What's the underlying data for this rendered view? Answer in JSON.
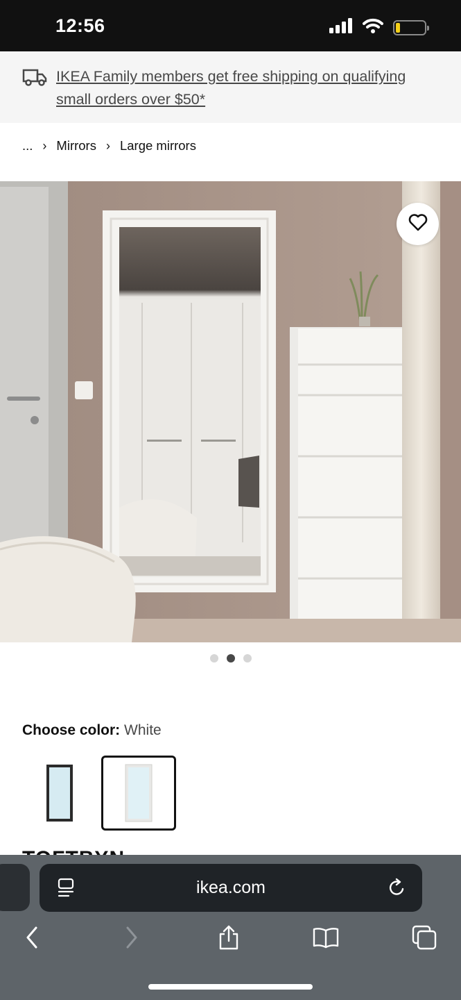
{
  "status": {
    "time": "12:56",
    "icons": [
      "signal-icon",
      "wifi-icon",
      "battery-icon"
    ],
    "battery_level": 0.15
  },
  "promo": {
    "icon": "truck-icon",
    "text": "IKEA Family members get free shipping on qualifying small orders over $50*"
  },
  "breadcrumb": {
    "items": [
      "...",
      "Mirrors",
      "Large mirrors"
    ],
    "separator": "›"
  },
  "gallery": {
    "favorite_icon": "heart-icon",
    "dots_count": 3,
    "active_dot": 2
  },
  "color": {
    "label": "Choose color:",
    "value": "White",
    "options": [
      {
        "name": "black-mirror-swatch",
        "frame_color": "#2b2b2b",
        "selected": false
      },
      {
        "name": "white-mirror-swatch",
        "frame_color": "#e6e6e6",
        "selected": true
      }
    ]
  },
  "product": {
    "title_partial": "TOFTBYN"
  },
  "browser": {
    "url": "ikea.com",
    "icons": [
      "reader-icon",
      "reload-icon",
      "back-icon",
      "forward-icon",
      "share-icon",
      "bookmarks-icon",
      "tabs-icon"
    ]
  },
  "colors": {
    "status_bg": "#111111",
    "promo_bg": "#f5f5f5",
    "browser_bg": "#5e6469",
    "urlbar_bg": "#1f2327",
    "wall": "#a89488",
    "accent_battery": "#f5d019"
  }
}
